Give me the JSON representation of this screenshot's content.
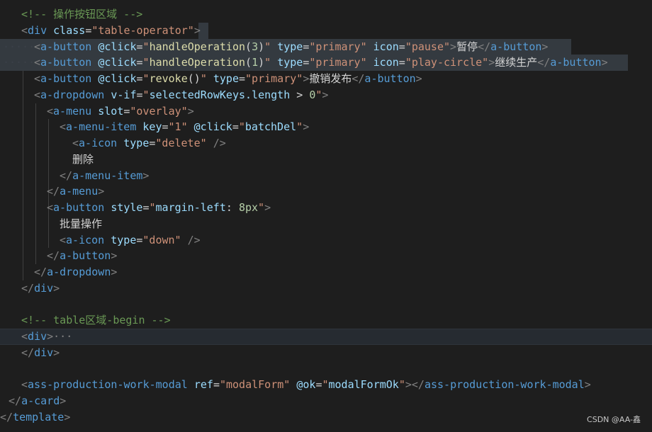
{
  "lines": [
    "<!-- 操作按钮区域 -->",
    "<div class=\"table-operator\">",
    "<a-button @click=\"handleOperation(3)\" type=\"primary\" icon=\"pause\">暂停</a-button>",
    "<a-button @click=\"handleOperation(1)\" type=\"primary\" icon=\"play-circle\">继续生产</a-button>",
    "<a-button @click=\"revoke()\" type=\"primary\">撤销发布</a-button>",
    "<a-dropdown v-if=\"selectedRowKeys.length > 0\">",
    "<a-menu slot=\"overlay\">",
    "<a-menu-item key=\"1\" @click=\"batchDel\">",
    "<a-icon type=\"delete\" />",
    "删除",
    "</a-menu-item>",
    "</a-menu>",
    "<a-button style=\"margin-left: 8px\">",
    "批量操作",
    "<a-icon type=\"down\" />",
    "</a-button>",
    "</a-dropdown>",
    "</div>",
    "",
    "<!-- table区域-begin -->",
    "<div>···",
    "</div>",
    "",
    "<ass-production-work-modal ref=\"modalForm\" @ok=\"modalFormOk\"></ass-production-work-modal>",
    "</a-card>",
    "</template>"
  ],
  "watermark": "CSDN @AA-鑫",
  "colors": {
    "background": "#1e1e1e",
    "comment": "#6a9955",
    "tag": "#569cd6",
    "attribute": "#9cdcfe",
    "string": "#ce9178",
    "function": "#dcdcaa",
    "number": "#b5cea8"
  }
}
